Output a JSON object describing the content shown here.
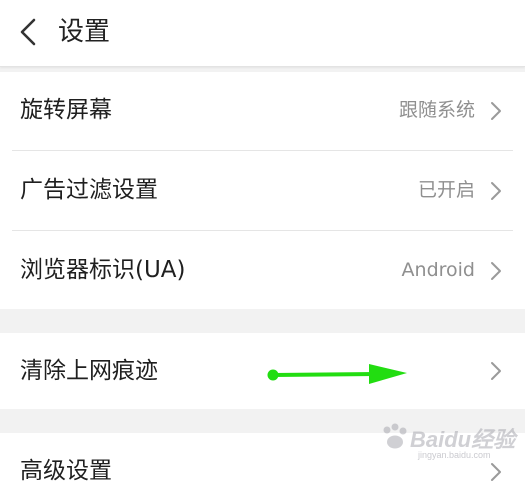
{
  "header": {
    "title": "设置",
    "back_icon": "chevron-left-icon"
  },
  "settings": {
    "rotate_screen": {
      "label": "旋转屏幕",
      "value": "跟随系统"
    },
    "ad_filter": {
      "label": "广告过滤设置",
      "value": "已开启"
    },
    "browser_ua": {
      "label": "浏览器标识(UA)",
      "value": "Android"
    },
    "clear_history": {
      "label": "清除上网痕迹"
    },
    "advanced": {
      "label": "高级设置"
    }
  },
  "annotation": {
    "arrow_color": "#22dd11"
  },
  "watermark": {
    "text": "Baidu经验",
    "sub": "jingyan.baidu.com"
  },
  "colors": {
    "background": "#f2f2f2",
    "row_background": "#ffffff",
    "label": "#1f1f1f",
    "value": "#8f8f8f",
    "chevron": "#9a9a9a"
  }
}
